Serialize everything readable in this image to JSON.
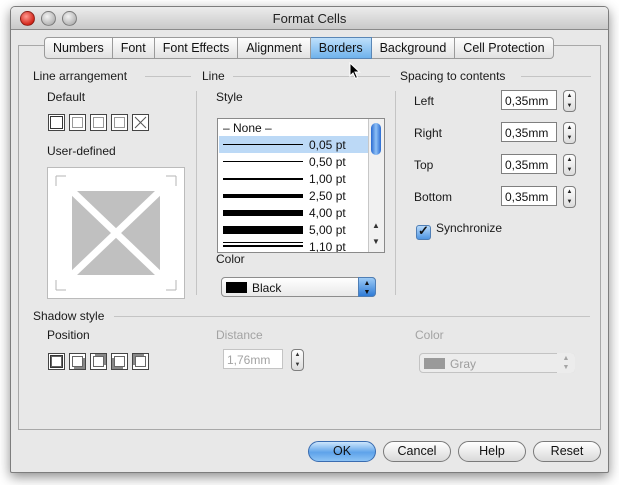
{
  "window": {
    "title": "Format Cells"
  },
  "tabs": [
    "Numbers",
    "Font",
    "Font Effects",
    "Alignment",
    "Borders",
    "Background",
    "Cell Protection"
  ],
  "active_tab": "Borders",
  "line_arrangement": {
    "heading": "Line arrangement",
    "default_label": "Default",
    "user_defined_label": "User-defined",
    "presets": [
      "no-border",
      "outer-border",
      "outer-and-horizontal",
      "outer-and-all",
      "diagonal-border"
    ]
  },
  "line": {
    "heading": "Line",
    "style_label": "Style",
    "styles": [
      "– None –",
      "0,05 pt",
      "0,50 pt",
      "1,00 pt",
      "2,50 pt",
      "4,00 pt",
      "5,00 pt",
      "1,10 pt"
    ],
    "selected_style": "0,05 pt",
    "color_label": "Color",
    "color_value": "Black"
  },
  "spacing": {
    "heading": "Spacing to contents",
    "left_label": "Left",
    "left_value": "0,35mm",
    "right_label": "Right",
    "right_value": "0,35mm",
    "top_label": "Top",
    "top_value": "0,35mm",
    "bottom_label": "Bottom",
    "bottom_value": "0,35mm",
    "synchronize_label": "Synchronize",
    "synchronize_checked": true
  },
  "shadow": {
    "heading": "Shadow style",
    "position_label": "Position",
    "distance_label": "Distance",
    "distance_value": "1,76mm",
    "color_label": "Color",
    "color_value": "Gray"
  },
  "buttons": {
    "ok": "OK",
    "cancel": "Cancel",
    "help": "Help",
    "reset": "Reset"
  },
  "colors": {
    "accent": "#5ea3ea",
    "selection": "#bcd9f6",
    "disabled_text": "#a3a3a3"
  }
}
